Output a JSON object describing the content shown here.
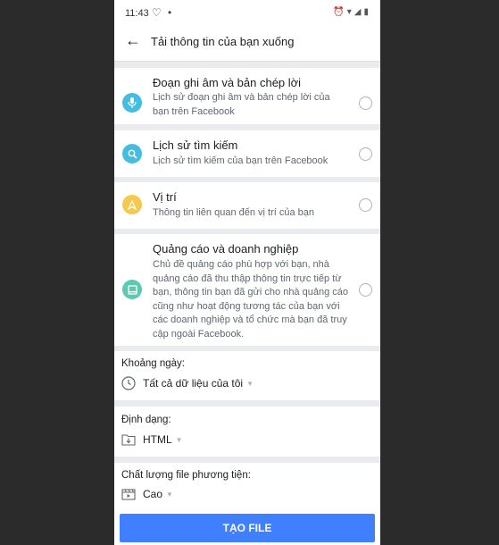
{
  "status_bar": {
    "time": "11:43",
    "left_icon": "heart-monitor-icon",
    "dot": "•",
    "right_icons": "⏰▾◢▮"
  },
  "app_bar": {
    "title": "Tải thông tin của bạn xuống"
  },
  "items": [
    {
      "title": "Đoạn ghi âm và bản chép lời",
      "description": "Lịch sử đoạn ghi âm và bản chép lời của bạn trên Facebook",
      "icon": "microphone-icon",
      "color": "#45bde0",
      "glyph": "🎙"
    },
    {
      "title": "Lịch sử tìm kiếm",
      "description": "Lịch sử tìm kiếm của bạn trên Facebook",
      "icon": "search-icon",
      "color": "#45bde0",
      "glyph": "⌕"
    },
    {
      "title": "Vị trí",
      "description": "Thông tin liên quan đến vị trí của bạn",
      "icon": "location-icon",
      "color": "#f7c84e",
      "glyph": "◬"
    },
    {
      "title": "Quảng cáo và doanh nghiệp",
      "description": "Chủ đề quảng cáo phù hợp với bạn, nhà quảng cáo đã thu thập thông tin trực tiếp từ bạn, thông tin bạn đã gửi cho nhà quảng cáo cũng như hoạt động tương tác của bạn với các doanh nghiệp và tổ chức mà bạn đã truy cập ngoài Facebook.",
      "icon": "ads-icon",
      "color": "#5ec8b0",
      "glyph": "▣"
    }
  ],
  "date_range": {
    "label": "Khoảng ngày:",
    "value": "Tất cả dữ liệu của tôi"
  },
  "format": {
    "label": "Định dạng:",
    "value": "HTML"
  },
  "media_quality": {
    "label": "Chất lượng file phương tiện:",
    "value": "Cao"
  },
  "create_button": {
    "label": "TẠO FILE"
  },
  "colors": {
    "accent": "#4080ff",
    "background": "#e9ebee"
  }
}
